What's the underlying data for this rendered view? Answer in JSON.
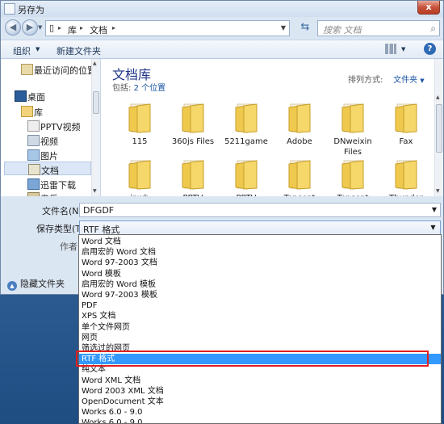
{
  "window": {
    "title": "另存为",
    "close_label": "x"
  },
  "address": {
    "crumbs": [
      "库",
      "文档"
    ],
    "search_placeholder": "搜索 文档"
  },
  "toolbar": {
    "organize": "组织",
    "new_folder": "新建文件夹"
  },
  "nav": {
    "items": [
      {
        "label": "最近访问的位置",
        "icon": "recent-places-icon"
      },
      {
        "label": "桌面",
        "icon": "desktop-icon"
      },
      {
        "label": "库",
        "icon": "library-icon"
      },
      {
        "label": "PPTV视频",
        "icon": "video-folder-icon"
      },
      {
        "label": "视频",
        "icon": "video-folder-icon"
      },
      {
        "label": "图片",
        "icon": "picture-folder-icon"
      },
      {
        "label": "文档",
        "icon": "document-folder-icon"
      },
      {
        "label": "迅雷下载",
        "icon": "download-folder-icon"
      },
      {
        "label": "音乐",
        "icon": "music-folder-icon"
      }
    ]
  },
  "library": {
    "title": "文档库",
    "includes_prefix": "包括:",
    "includes_link": "2 个位置",
    "arrange_label": "排列方式:",
    "arrange_value": "文件夹"
  },
  "folders": [
    "115",
    "360js Files",
    "5211game",
    "Adobe",
    "DNweixin Files",
    "Fax",
    "jpwb",
    "PPTV",
    "PPTV",
    "Tencent",
    "Tencent",
    "Thunder"
  ],
  "form": {
    "filename_label": "文件名(N):",
    "filename_value": "DFGDF",
    "filetype_label": "保存类型(T):",
    "filetype_value": "RTF 格式",
    "author_label": "作者:",
    "hide_folders": "隐藏文件夹"
  },
  "filetype_options": [
    "Word 文档",
    "启用宏的 Word 文档",
    "Word 97-2003 文档",
    "Word 模板",
    "启用宏的 Word 模板",
    "Word 97-2003 模板",
    "PDF",
    "XPS 文档",
    "单个文件网页",
    "网页",
    "筛选过的网页",
    "RTF 格式",
    "纯文本",
    "Word XML 文档",
    "Word 2003 XML 文档",
    "OpenDocument 文本",
    "Works 6.0 - 9.0",
    "Works 6.0 - 9.0"
  ],
  "selected_option_index": 11,
  "colors": {
    "selection": "#3399ff",
    "highlight_box": "#e02020",
    "link": "#1a55a5"
  }
}
